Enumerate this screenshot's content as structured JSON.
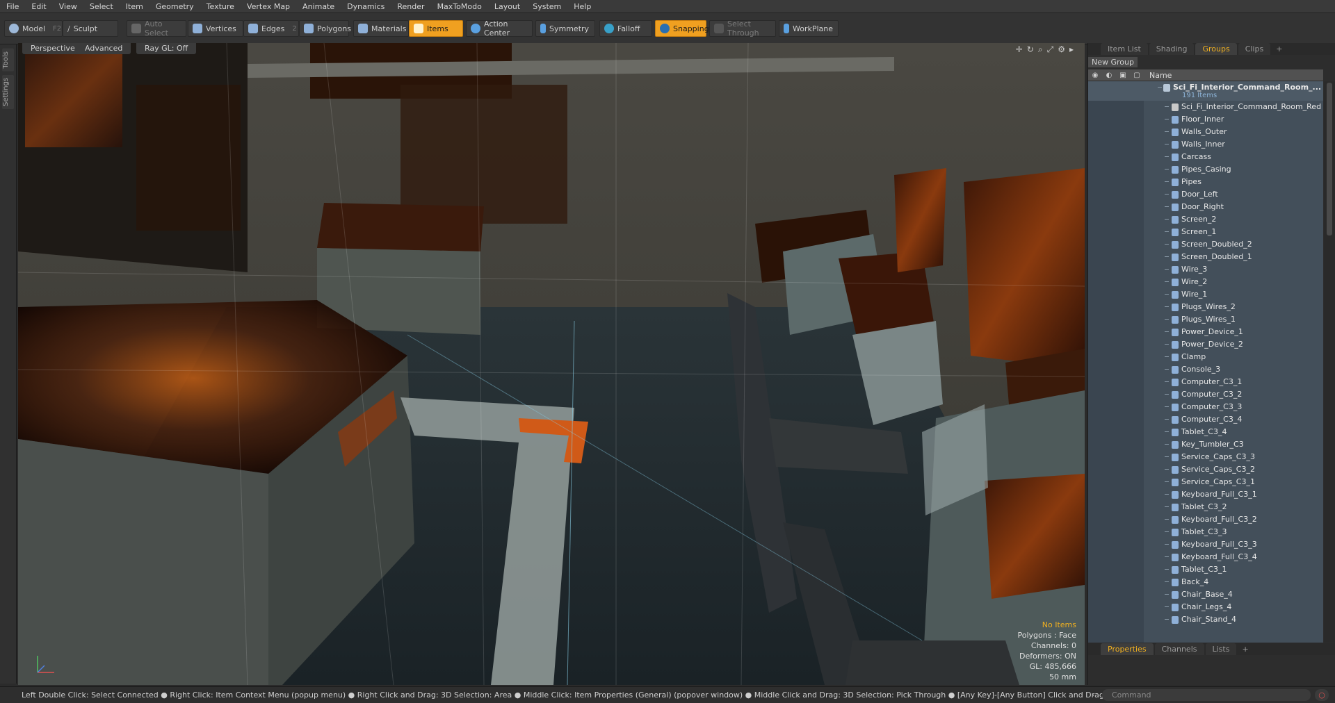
{
  "menu": [
    "File",
    "Edit",
    "View",
    "Select",
    "Item",
    "Geometry",
    "Texture",
    "Vertex Map",
    "Animate",
    "Dynamics",
    "Render",
    "MaxToModo",
    "Layout",
    "System",
    "Help"
  ],
  "toolbar": {
    "model": "Model",
    "model_key": "F2",
    "sculpt": "Sculpt",
    "auto_select": "Auto Select",
    "vertices": "Vertices",
    "vertices_count": "1",
    "edges": "Edges",
    "edges_count": "2",
    "polygons": "Polygons",
    "materials": "Materials",
    "items": "Items",
    "action_center": "Action Center",
    "symmetry": "Symmetry",
    "falloff": "Falloff",
    "snapping": "Snapping",
    "select_through": "Select Through",
    "workplane": "WorkPlane"
  },
  "left_dock": {
    "tools": "Tools",
    "settings": "Settings"
  },
  "viewport": {
    "perspective": "Perspective",
    "advanced": "Advanced",
    "raygl": "Ray GL: Off",
    "hud": {
      "selection": "No Items",
      "polygons": "Polygons : Face",
      "channels": "Channels: 0",
      "deformers": "Deformers: ON",
      "gl": "GL: 485,666",
      "lens": "50 mm"
    }
  },
  "right_panel": {
    "tabs": [
      "Item List",
      "Shading",
      "Groups",
      "Clips"
    ],
    "selected_tab": "Groups",
    "new_group": "New Group",
    "column_name": "Name",
    "group": {
      "name": "Sci_Fi_Interior_Command_Room_...",
      "count": "191 Items"
    },
    "items": [
      "Sci_Fi_Interior_Command_Room_Red",
      "Floor_Inner",
      "Walls_Outer",
      "Walls_Inner",
      "Carcass",
      "Pipes_Casing",
      "Pipes",
      "Door_Left",
      "Door_Right",
      "Screen_2",
      "Screen_1",
      "Screen_Doubled_2",
      "Screen_Doubled_1",
      "Wire_3",
      "Wire_2",
      "Wire_1",
      "Plugs_Wires_2",
      "Plugs_Wires_1",
      "Power_Device_1",
      "Power_Device_2",
      "Clamp",
      "Console_3",
      "Computer_C3_1",
      "Computer_C3_2",
      "Computer_C3_3",
      "Computer_C3_4",
      "Tablet_C3_4",
      "Key_Tumbler_C3",
      "Service_Caps_C3_3",
      "Service_Caps_C3_2",
      "Service_Caps_C3_1",
      "Keyboard_Full_C3_1",
      "Tablet_C3_2",
      "Keyboard_Full_C3_2",
      "Tablet_C3_3",
      "Keyboard_Full_C3_3",
      "Keyboard_Full_C3_4",
      "Tablet_C3_1",
      "Back_4",
      "Chair_Base_4",
      "Chair_Legs_4",
      "Chair_Stand_4"
    ]
  },
  "bottom_tabs": [
    "Properties",
    "Channels",
    "Lists"
  ],
  "bottom_selected": "Properties",
  "status": {
    "message": "Left Double Click: Select Connected ● Right Click: Item Context Menu (popup menu) ● Right Click and Drag: 3D Selection: Area ● Middle Click: Item Properties (General) (popover window) ● Middle Click and Drag: 3D Selection: Pick Through ● [Any Key]-[Any Button] Click and Drag: dragDropBegin",
    "command_placeholder": "Command"
  },
  "colors": {
    "accent": "#f0a020",
    "tree_bg": "#434f5a",
    "glow": "#ff7a10"
  }
}
